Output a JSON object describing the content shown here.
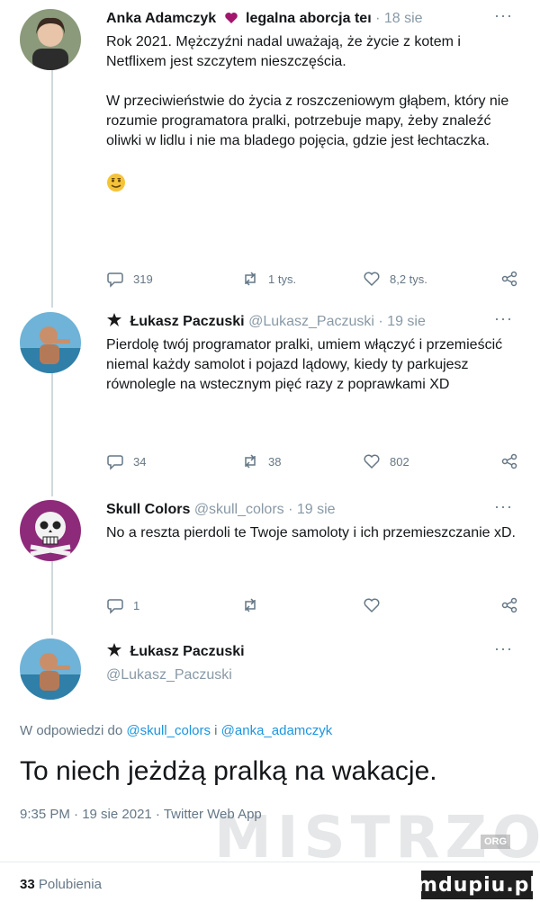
{
  "tweets": [
    {
      "name": "Anka Adamczyk",
      "name_suffix": "legalna aborcja teı",
      "meta": "· 18 sie",
      "text": "Rok 2021. Mężczyźni nadal uważają, że życie z kotem i Netflixem jest szczytem nieszczęścia.\n\nW przeciwieństwie do życia z roszczeniowym głąbem, który nie rozumie programatora pralki, potrzebuje mapy, żeby znaleźć oliwki w lidlu i nie ma bladego pojęcia, gdzie jest łechtaczka.",
      "stats": {
        "replies": "319",
        "retweets": "1 tys.",
        "likes": "8,2 tys."
      }
    },
    {
      "name": "Łukasz Paczuski",
      "handle": "@Lukasz_Paczuski",
      "meta": "· 19 sie",
      "text": "Pierdolę twój programator pralki, umiem włączyć i przemieścić niemal każdy samolot i pojazd lądowy, kiedy ty parkujesz równolegle na wstecznym pięć razy z poprawkami XD",
      "stats": {
        "replies": "34",
        "retweets": "38",
        "likes": "802"
      }
    },
    {
      "name": "Skull Colors",
      "handle": "@skull_colors",
      "meta": "· 19 sie",
      "text": "No a reszta pierdoli te Twoje samoloty i ich przemieszczanie xD.",
      "stats": {
        "replies": "1",
        "retweets": "",
        "likes": ""
      }
    }
  ],
  "focus": {
    "name": "Łukasz Paczuski",
    "handle": "@Lukasz_Paczuski",
    "reply_prefix": "W odpowiedzi do ",
    "reply_mention1": "@skull_colors",
    "reply_and": " i ",
    "reply_mention2": "@anka_adamczyk",
    "text": "To niech jeżdżą pralką na wakacje.",
    "meta": "9:35 PM · 19 sie 2021 · Twitter Web App",
    "likes_count": "33",
    "likes_label": "Polubienia"
  },
  "watermark": {
    "text": "MISTRZOWIE",
    "tag": "ORG"
  },
  "brand": "mdupiu.pl",
  "more_label": "···",
  "icons": [
    "reply-icon",
    "retweet-icon",
    "like-icon",
    "share-icon",
    "verified-icon",
    "heart-icon",
    "emoji-icon"
  ]
}
